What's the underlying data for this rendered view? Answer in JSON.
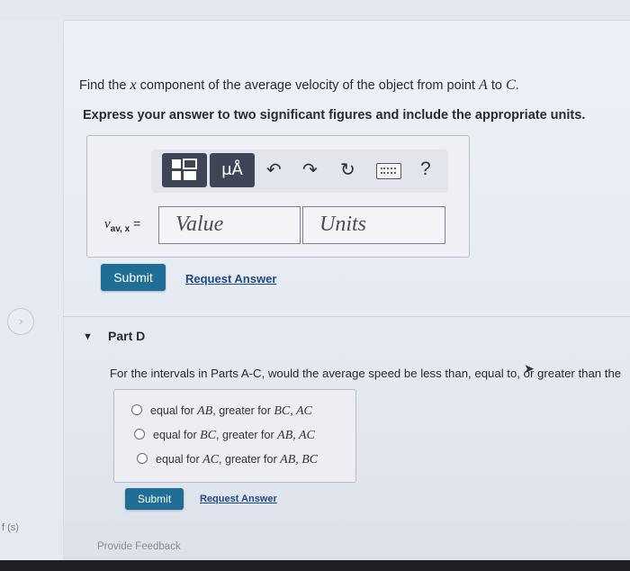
{
  "question": {
    "prefix": "Find the",
    "var": "x",
    "middle": "component of the average velocity of the object from point",
    "point_a": "A",
    "to": "to",
    "point_c": "C",
    "period": "."
  },
  "instruction": "Express your answer to two significant figures and include the appropriate units.",
  "toolbar": {
    "templates_icon": "templates-icon",
    "units_label": "μÅ",
    "undo_icon": "↶",
    "redo_icon": "↷",
    "reset_icon": "↻",
    "keyboard_icon": "keyboard-icon",
    "help_label": "?"
  },
  "answer": {
    "var_symbol": "v",
    "var_subscript": "av, x",
    "equals": "=",
    "value_placeholder": "Value",
    "units_placeholder": "Units"
  },
  "actions": {
    "submit": "Submit",
    "request": "Request Answer"
  },
  "part_d": {
    "title": "Part D",
    "question": "For the intervals in Parts A-C, would the average speed be less than, equal to, or greater than the",
    "options": [
      {
        "pre": "equal for",
        "m1": "AB",
        "mid": ", greater for",
        "m2": "BC, AC"
      },
      {
        "pre": "equal for",
        "m1": "BC",
        "mid": ", greater for",
        "m2": "AB, AC"
      },
      {
        "pre": "equal for",
        "m1": "AC",
        "mid": ", greater for",
        "m2": "AB, BC"
      }
    ],
    "submit": "Submit",
    "request": "Request Answer"
  },
  "feedback": "Provide Feedback",
  "side": {
    "nav_arrow": "›",
    "fs_label": "f (s)"
  }
}
